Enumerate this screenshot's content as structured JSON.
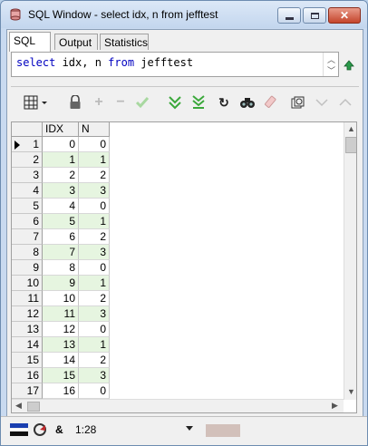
{
  "window": {
    "title": "SQL Window - select idx, n from jefftest"
  },
  "tabs": [
    {
      "label": "SQL"
    },
    {
      "label": "Output"
    },
    {
      "label": "Statistics"
    }
  ],
  "editor": {
    "keyword1": "select",
    "part2": " idx, n ",
    "keyword2": "from",
    "part4": " jefftest"
  },
  "grid": {
    "columns": [
      "IDX",
      "N"
    ],
    "rows": [
      {
        "num": "1",
        "idx": "0",
        "n": "0"
      },
      {
        "num": "2",
        "idx": "1",
        "n": "1"
      },
      {
        "num": "3",
        "idx": "2",
        "n": "2"
      },
      {
        "num": "4",
        "idx": "3",
        "n": "3"
      },
      {
        "num": "5",
        "idx": "4",
        "n": "0"
      },
      {
        "num": "6",
        "idx": "5",
        "n": "1"
      },
      {
        "num": "7",
        "idx": "6",
        "n": "2"
      },
      {
        "num": "8",
        "idx": "7",
        "n": "3"
      },
      {
        "num": "9",
        "idx": "8",
        "n": "0"
      },
      {
        "num": "10",
        "idx": "9",
        "n": "1"
      },
      {
        "num": "11",
        "idx": "10",
        "n": "2"
      },
      {
        "num": "12",
        "idx": "11",
        "n": "3"
      },
      {
        "num": "13",
        "idx": "12",
        "n": "0"
      },
      {
        "num": "14",
        "idx": "13",
        "n": "1"
      },
      {
        "num": "15",
        "idx": "14",
        "n": "2"
      },
      {
        "num": "16",
        "idx": "15",
        "n": "3"
      },
      {
        "num": "17",
        "idx": "16",
        "n": "0"
      }
    ]
  },
  "status": {
    "cursor_position": "1:28",
    "ampersand": "&"
  },
  "colors": {
    "alt_row": "#e6f5e0",
    "keyword": "#0000c0",
    "accent_green": "#3aa83a"
  },
  "icons": [
    "sql-window-icon",
    "minimize-icon",
    "maximize-icon",
    "close-icon",
    "up-arrow-icon",
    "grid-view-icon",
    "lock-icon",
    "insert-record-icon",
    "delete-record-icon",
    "post-record-icon",
    "next-page-icon",
    "last-page-icon",
    "refresh-icon",
    "find-icon",
    "clear-icon",
    "export-icon",
    "previous-icon",
    "next-icon"
  ]
}
